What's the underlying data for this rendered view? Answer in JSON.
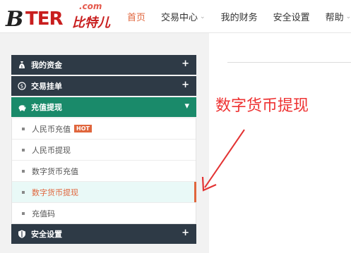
{
  "logo": {
    "letter_b": "B",
    "word": "TER",
    "domain": ".com",
    "chinese": "比特儿"
  },
  "nav": [
    {
      "label": "首页",
      "active": true,
      "dropdown": false
    },
    {
      "label": "交易中心",
      "active": false,
      "dropdown": true
    },
    {
      "label": "我的财务",
      "active": false,
      "dropdown": false
    },
    {
      "label": "安全设置",
      "active": false,
      "dropdown": false
    },
    {
      "label": "帮助",
      "active": false,
      "dropdown": true
    }
  ],
  "menu": {
    "sections": [
      {
        "label": "我的资金",
        "icon": "money-bag-icon",
        "toggle": "+"
      },
      {
        "label": "交易挂单",
        "icon": "exchange-icon",
        "toggle": "+"
      },
      {
        "label": "充值提现",
        "icon": "piggy-bank-icon",
        "toggle": "▾"
      },
      {
        "label": "安全设置",
        "icon": "shield-icon",
        "toggle": "+"
      }
    ],
    "items": [
      {
        "label": "人民币充值",
        "badge": "HOT"
      },
      {
        "label": "人民币提现"
      },
      {
        "label": "数字货币充值"
      },
      {
        "label": "数字货币提现"
      },
      {
        "label": "充值码"
      }
    ]
  },
  "annotation": "数字货币提现",
  "colors": {
    "accent": "#e0663d",
    "menu_dark": "#2e3a46",
    "menu_active": "#1a8a6a",
    "annotation": "#e33333"
  }
}
